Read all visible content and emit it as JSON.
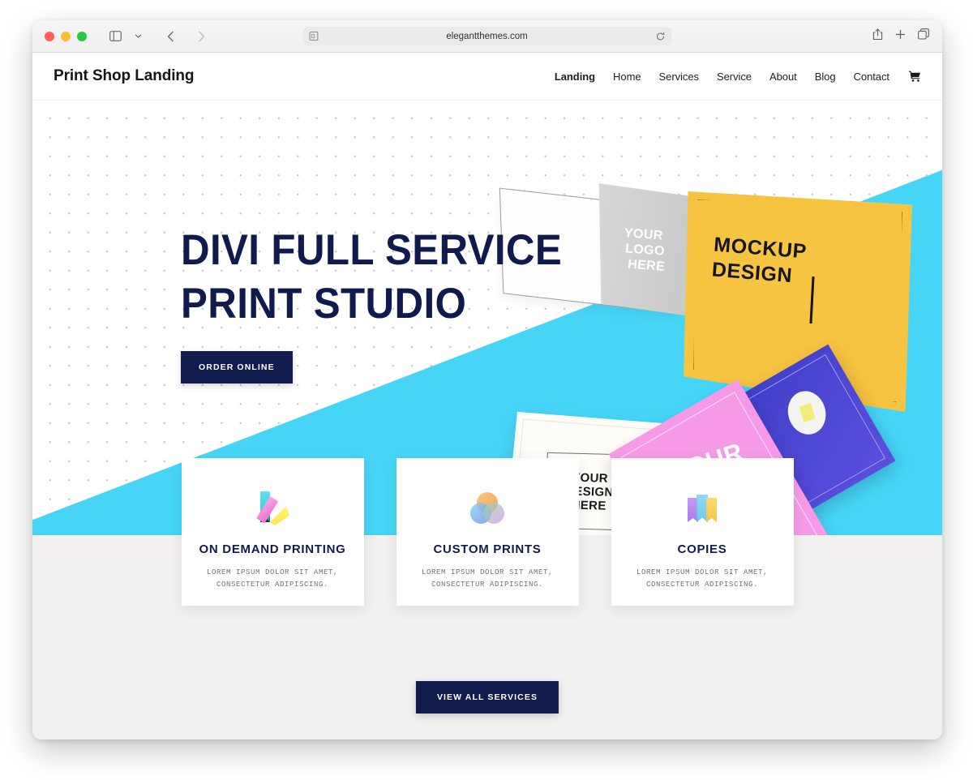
{
  "browser": {
    "url": "elegantthemes.com",
    "traffic_lights": [
      "close",
      "minimize",
      "maximize"
    ],
    "icons": {
      "sidebar": "sidebar-icon",
      "sidebar_chevron": "chevron-down-icon",
      "back": "back-arrow-icon",
      "forward": "forward-arrow-icon",
      "shield": "reader-icon",
      "reload": "reload-icon",
      "share": "share-icon",
      "new_tab": "plus-icon",
      "tabs": "tabs-icon"
    }
  },
  "site": {
    "brand": "Print Shop Landing",
    "nav": [
      {
        "label": "Landing",
        "active": true
      },
      {
        "label": "Home",
        "active": false
      },
      {
        "label": "Services",
        "active": false
      },
      {
        "label": "Service",
        "active": false
      },
      {
        "label": "About",
        "active": false
      },
      {
        "label": "Blog",
        "active": false
      },
      {
        "label": "Contact",
        "active": false
      }
    ],
    "cart_icon": "shopping-cart-icon",
    "hero": {
      "title": "DIVI FULL SERVICE\nPRINT STUDIO",
      "cta": "ORDER ONLINE",
      "art": {
        "grey_card_label": "YOUR\nLOGO\nHERE",
        "yellow_card_label": "MOCKUP\nDESIGN",
        "white_card_label": "YOUR\nDESIGN\nHERE",
        "pink_card_label": "YOUR\nLOGO\nHERE"
      }
    },
    "services": {
      "cards": [
        {
          "icon": "color-swatch-icon",
          "title": "ON DEMAND PRINTING",
          "desc": "LOREM IPSUM DOLOR SIT AMET,\nCONSECTETUR ADIPISCING."
        },
        {
          "icon": "overlapping-circles-icon",
          "title": "CUSTOM PRINTS",
          "desc": "LOREM IPSUM DOLOR SIT AMET,\nCONSECTETUR ADIPISCING."
        },
        {
          "icon": "stacked-pages-icon",
          "title": "COPIES",
          "desc": "LOREM IPSUM DOLOR SIT AMET,\nCONSECTETUR ADIPISCING."
        }
      ],
      "view_all": "VIEW ALL SERVICES"
    }
  },
  "colors": {
    "navy": "#111c4e",
    "cyan": "#46d5f7",
    "yellow": "#f6c440",
    "pink": "#f69ae8",
    "blue": "#4a44d4",
    "section_bg": "#f2f1ef"
  }
}
